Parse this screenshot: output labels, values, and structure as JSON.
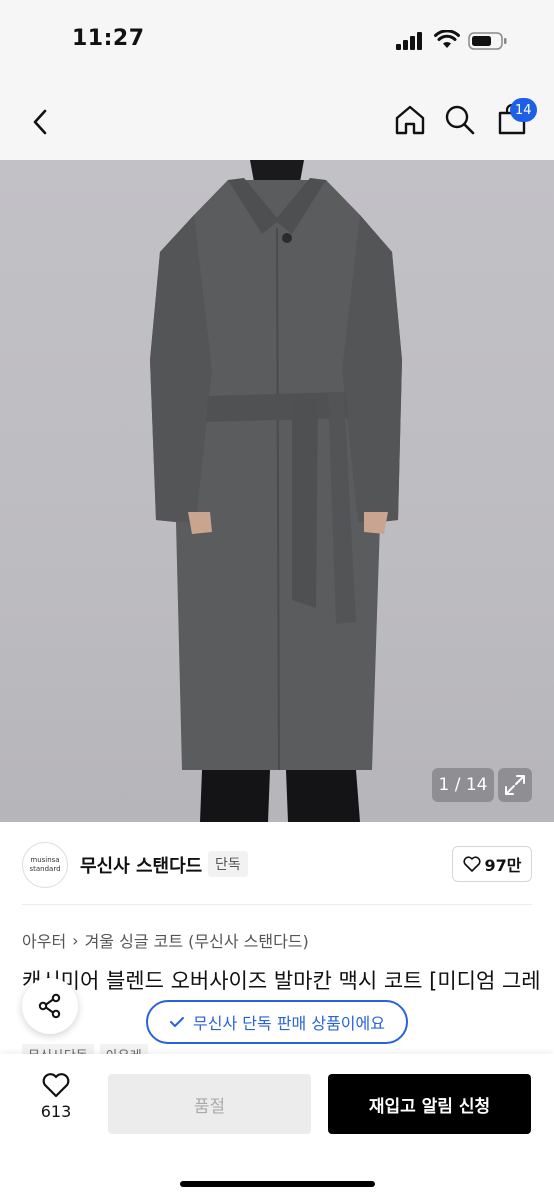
{
  "status_bar": {
    "time": "11:27"
  },
  "nav": {
    "cart_count": "14"
  },
  "gallery": {
    "counter": "1 / 14"
  },
  "brand": {
    "logo_line1": "musinsa",
    "logo_line2": "standard",
    "name": "무신사 스탠다드",
    "badge": "단독",
    "likes": "97만"
  },
  "breadcrumb": {
    "level1": "아우터",
    "separator": "›",
    "level2": "겨울 싱글 코트 (무신사 스탠다드)"
  },
  "product": {
    "title": "캐시미어 블렌드 오버사이즈 발마칸 맥시 코트 [미디엄 그레이]"
  },
  "exclusive_pill": {
    "label": "무신사 단독 판매 상품이에요"
  },
  "tags": [
    "무신사단독",
    "아우레"
  ],
  "bottom_bar": {
    "like_count": "613",
    "soldout_label": "품절",
    "restock_label": "재입고 알림 신청"
  },
  "colors": {
    "accent_blue": "#2a63d9",
    "badge_blue": "#1d5fe6",
    "coat_gray": "#5b5c5e",
    "background_gray": "#c0bfc4"
  }
}
